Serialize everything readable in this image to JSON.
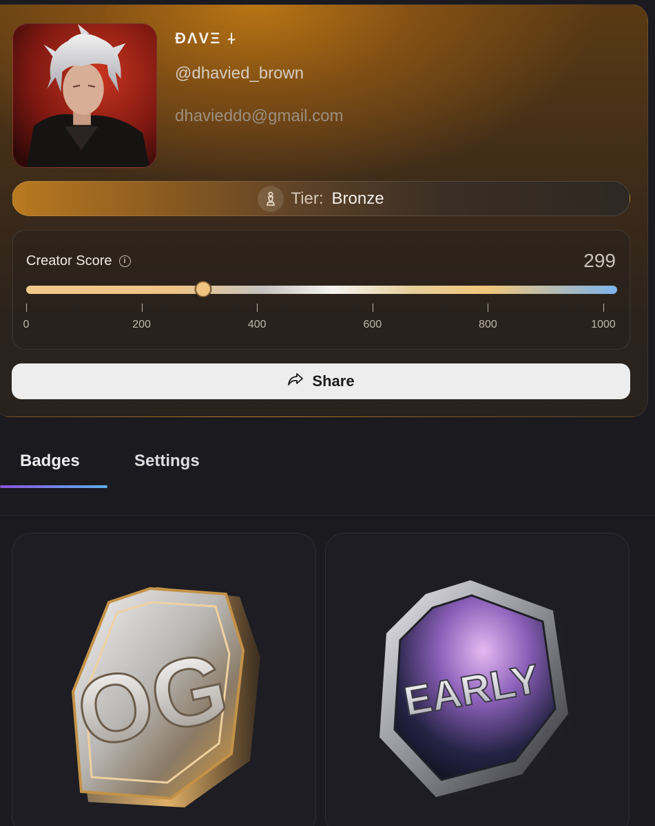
{
  "profile": {
    "display_name": "ĐΛVΞ ⍭",
    "handle": "@dhavied_brown",
    "email": "dhavieddo@gmail.com"
  },
  "tier": {
    "prefix": "Tier:",
    "value": "Bronze"
  },
  "creator_score": {
    "title": "Creator Score",
    "value": "299",
    "min": 0,
    "max": 1000,
    "ticks": [
      "0",
      "200",
      "400",
      "600",
      "800",
      "1000"
    ]
  },
  "share": {
    "label": "Share"
  },
  "tabs": [
    {
      "label": "Badges",
      "active": true
    },
    {
      "label": "Settings",
      "active": false
    }
  ],
  "badges": [
    {
      "text": "OG"
    },
    {
      "text": "EARLY"
    }
  ],
  "colors": {
    "tier_accent": "#b97a21",
    "tab_underline_start": "#8d52d9",
    "tab_underline_end": "#5fb0f2",
    "share_bg": "#ededed"
  }
}
